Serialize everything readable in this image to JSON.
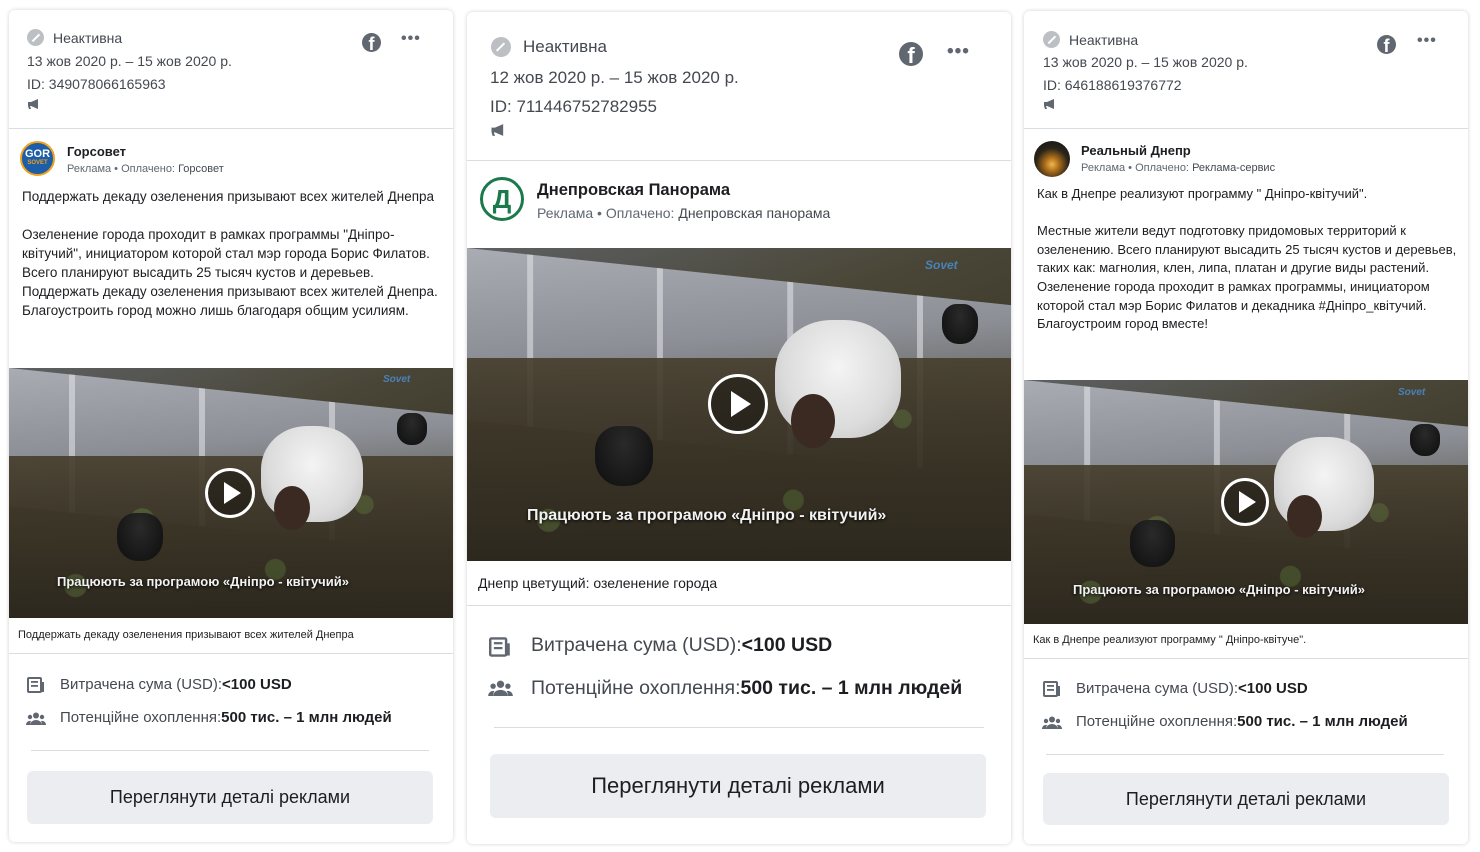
{
  "cards": [
    {
      "status": "Неактивна",
      "dates": "13 жов 2020 р. – 15 жов 2020 р.",
      "ad_id": "ID: 349078066165963",
      "advertiser": "Горсовет",
      "avatar_text": "GOR",
      "avatar_sub": "SOVET",
      "sponsored_prefix": "Реклама • Оплачено: ",
      "paid_by": "Горсовет",
      "body": "Поддержать декаду озеленения призывают всех жителей Днепра\n\nОзеленение города проходит в рамках программы \"Дніпро-квітучий\", инициатором которой стал мэр города Борис Филатов. Всего планируют высадить 25 тысяч кустов и деревьев. Поддержать декаду озеленения призывают всех жителей Днепра. Благоустроить город можно лишь благодаря общим усилиям.",
      "video_subtitle": "Працюють за програмою «Дніпро - квітучий»",
      "caption": "Поддержать декаду озеленения призывают всех жителей Днепра",
      "spend_label": "Витрачена сума (USD): ",
      "spend_value": "<100 USD",
      "reach_label": "Потенційне охоплення: ",
      "reach_value": "500 тис. – 1 млн людей",
      "button": "Переглянути деталі реклами"
    },
    {
      "status": "Неактивна",
      "dates": "12 жов 2020 р. – 15 жов 2020 р.",
      "ad_id": "ID: 711446752782955",
      "advertiser": "Днепровская Панорама",
      "avatar_text": "Д",
      "sponsored_prefix": "Реклама • Оплачено: ",
      "paid_by": "Днепровская панорама",
      "video_subtitle": "Працюють за програмою «Дніпро - квітучий»",
      "caption": "Днепр цветущий: озеленение города",
      "spend_label": "Витрачена сума (USD): ",
      "spend_value": "<100 USD",
      "reach_label": "Потенційне охоплення: ",
      "reach_value": "500 тис. – 1 млн людей",
      "button": "Переглянути деталі реклами"
    },
    {
      "status": "Неактивна",
      "dates": "13 жов 2020 р. – 15 жов 2020 р.",
      "ad_id": "ID: 646188619376772",
      "advertiser": "Реальный Днепр",
      "sponsored_prefix": "Реклама • Оплачено: ",
      "paid_by": "Реклама-сервис",
      "body": "Как в Днепре реализуют программу \" Дніпро-квітучий\".\n\nМестные жители ведут подготовку придомовых территорий к озеленению. Всего планируют высадить 25 тысяч кустов и деревьев, таких как: магнолия, клен, липа, платан и другие виды растений.\nОзеленение города проходит в рамках программы, инициатором которой стал мэр Борис Филатов и декадника #Дніпро_квітучий.\nБлагоустроим город вместе!",
      "video_subtitle": "Працюють за програмою «Дніпро - квітучий»",
      "caption": "Как в Днепре реализуют программу \" Дніпро-квітуче\".",
      "spend_label": "Витрачена сума (USD): ",
      "spend_value": "<100 USD",
      "reach_label": "Потенційне охоплення: ",
      "reach_value": "500 тис. – 1 млн людей",
      "button": "Переглянути деталі реклами"
    }
  ],
  "icons": {
    "status": "inactive-status-icon",
    "platform": "facebook-icon",
    "menu": "more-options-icon",
    "ad_type": "megaphone-icon",
    "spend": "receipt-icon",
    "reach": "people-icon",
    "play": "play-icon"
  },
  "colors": {
    "button_bg": "#ebedf0",
    "divider": "#dadde1",
    "watermark": "#4a90d9",
    "panorama_green": "#1a7a4c"
  }
}
